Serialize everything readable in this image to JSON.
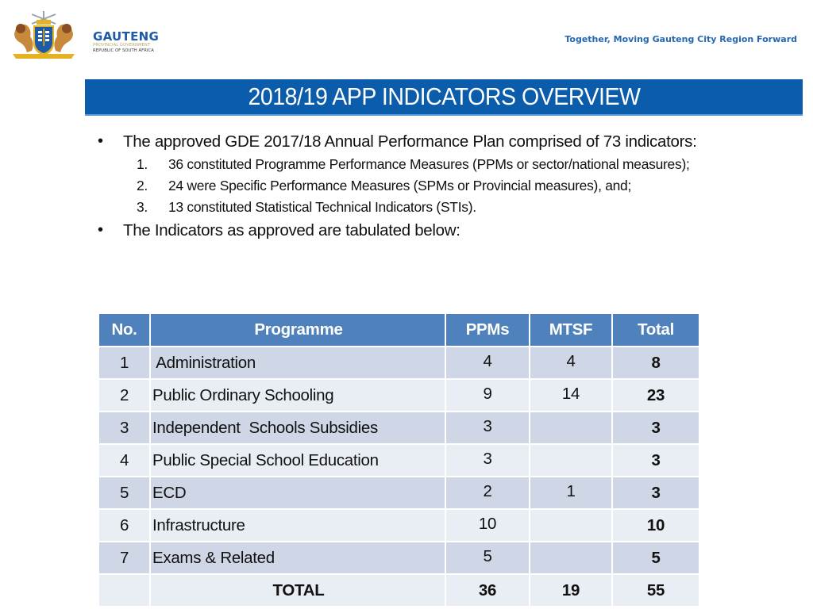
{
  "header": {
    "brand_name": "GAUTENG",
    "brand_line1": "PROVINCIAL GOVERNMENT",
    "brand_line2": "REPUBLIC OF SOUTH AFRICA",
    "tagline": "Together, Moving Gauteng City Region Forward",
    "crest_icon": "coat-of-arms-icon"
  },
  "colors": {
    "brand_blue": "#1f5aa6",
    "title_bar": "#0b5cab",
    "table_header": "#4f81bd",
    "row_dark": "#cfd7e6",
    "row_light": "#e9edf4"
  },
  "title": "2018/19 APP INDICATORS OVERVIEW",
  "body": {
    "bullet1": "The approved GDE 2017/18 Annual Performance Plan comprised of 73 indicators:",
    "subitems": [
      {
        "num": "1.",
        "text": "36 constituted Programme Performance Measures (PPMs or sector/national measures);"
      },
      {
        "num": "2.",
        "text": "24 were Specific Performance Measures (SPMs or Provincial measures), and;"
      },
      {
        "num": "3.",
        "text": "13 constituted Statistical Technical Indicators (STIs)."
      }
    ],
    "bullet2": "The Indicators as approved are tabulated below:",
    "bullet_glyph": "•"
  },
  "table": {
    "headers": [
      "No.",
      "Programme",
      "PPMs",
      "MTSF",
      "Total"
    ],
    "rows": [
      {
        "no": "1",
        "programme": " Administration",
        "ppms": "4",
        "mtsf": "4",
        "total": "8"
      },
      {
        "no": "2",
        "programme": "Public Ordinary Schooling",
        "ppms": "9",
        "mtsf": "14",
        "total": "23"
      },
      {
        "no": "3",
        "programme": "Independent  Schools Subsidies",
        "ppms": "3",
        "mtsf": "",
        "total": "3"
      },
      {
        "no": "4",
        "programme": "Public Special School Education",
        "ppms": "3",
        "mtsf": "",
        "total": "3"
      },
      {
        "no": "5",
        "programme": "ECD",
        "ppms": "2",
        "mtsf": "1",
        "total": "3"
      },
      {
        "no": "6",
        "programme": "Infrastructure",
        "ppms": "10",
        "mtsf": "",
        "total": "10"
      },
      {
        "no": "7",
        "programme": "Exams & Related",
        "ppms": "5",
        "mtsf": "",
        "total": "5"
      }
    ],
    "total_row": {
      "no": "",
      "label": "TOTAL",
      "ppms": "36",
      "mtsf": "19",
      "total": "55"
    }
  }
}
